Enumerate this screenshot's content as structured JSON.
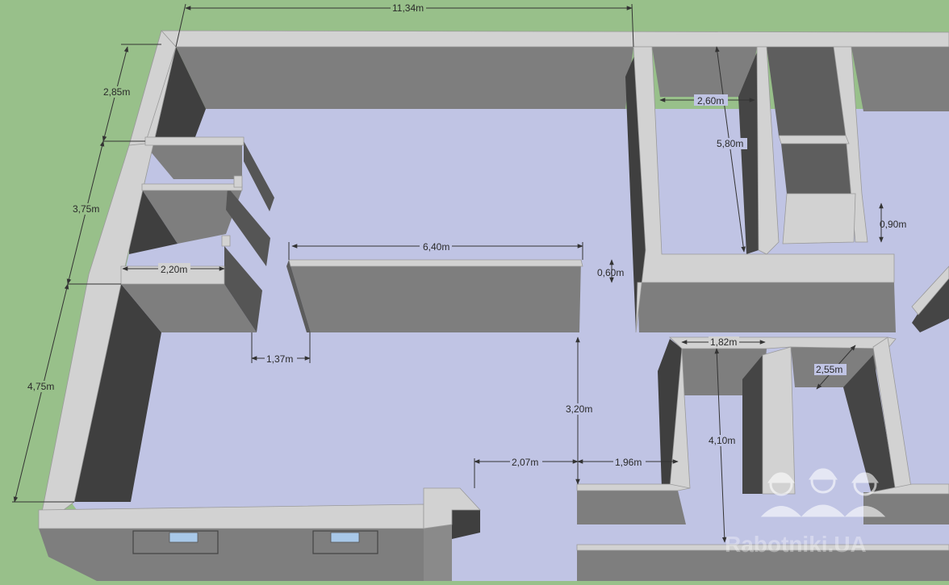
{
  "colors": {
    "ground": "#98c08a",
    "floor": "#c0c4e4",
    "wall_top": "#d2d2d2",
    "wall_face": "#7e7e7e",
    "wall_dark": "#454545",
    "window_glass": "#a8c8e8",
    "dim_line": "#333333",
    "watermark": "#ffffff"
  },
  "dimensions": {
    "d_11_34": "11,34m",
    "d_2_85": "2,85m",
    "d_3_75": "3,75m",
    "d_4_75": "4,75m",
    "d_2_20": "2,20m",
    "d_6_40": "6,40m",
    "d_0_60": "0,60m",
    "d_1_37": "1,37m",
    "d_2_60": "2,60m",
    "d_5_80": "5,80m",
    "d_0_90": "0,90m",
    "d_3_20": "3,20m",
    "d_1_82": "1,82m",
    "d_2_55": "2,55m",
    "d_4_10": "4,10m",
    "d_2_07": "2,07m",
    "d_1_96": "1,96m"
  },
  "watermark": {
    "text": "Rabotniki.UA",
    "icon": "workers-hardhat-icon"
  }
}
